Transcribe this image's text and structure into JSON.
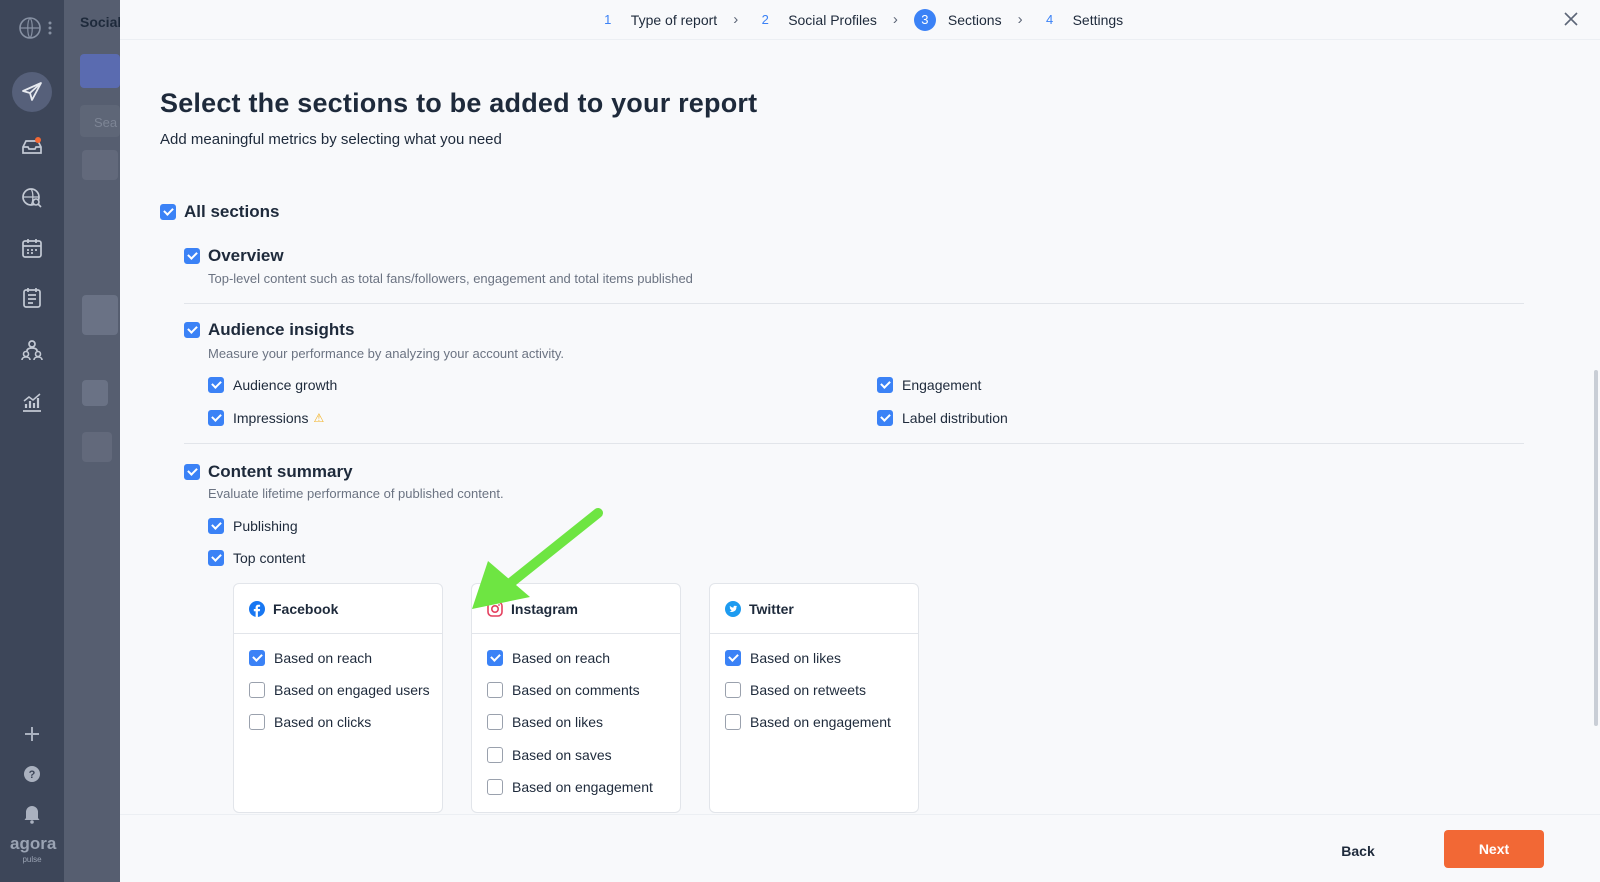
{
  "backdrop": {
    "title": "Social",
    "search_placeholder": "Sea"
  },
  "rail": {
    "logo": "agora",
    "logo_sub": "pulse",
    "icons": [
      "globe-logo-icon",
      "more-icon",
      "send-icon",
      "inbox-icon",
      "listening-icon",
      "calendar-icon",
      "notes-icon",
      "team-icon",
      "reports-icon",
      "add-icon",
      "help-icon",
      "bell-icon"
    ]
  },
  "stepper": {
    "steps": [
      {
        "num": "1",
        "label": "Type of report"
      },
      {
        "num": "2",
        "label": "Social Profiles"
      },
      {
        "num": "3",
        "label": "Sections",
        "active": true
      },
      {
        "num": "4",
        "label": "Settings"
      }
    ]
  },
  "header": {
    "title": "Select the sections to be added to your report",
    "subtitle": "Add meaningful metrics by selecting what you need"
  },
  "sections": {
    "all": {
      "label": "All sections",
      "checked": true
    },
    "overview": {
      "label": "Overview",
      "desc": "Top-level content such as total fans/followers, engagement and total items published",
      "checked": true
    },
    "audience": {
      "label": "Audience insights",
      "desc": "Measure your performance by analyzing your account activity.",
      "checked": true,
      "items": {
        "growth": "Audience growth",
        "impressions": "Impressions",
        "engagement": "Engagement",
        "labels": "Label distribution"
      }
    },
    "content": {
      "label": "Content summary",
      "desc": "Evaluate lifetime performance of published content.",
      "checked": true,
      "publishing": "Publishing",
      "top": "Top content"
    }
  },
  "cards": {
    "facebook": {
      "name": "Facebook",
      "options": [
        {
          "label": "Based on reach",
          "checked": true
        },
        {
          "label": "Based on engaged users",
          "checked": false
        },
        {
          "label": "Based on clicks",
          "checked": false
        }
      ]
    },
    "instagram": {
      "name": "Instagram",
      "options": [
        {
          "label": "Based on reach",
          "checked": true
        },
        {
          "label": "Based on comments",
          "checked": false
        },
        {
          "label": "Based on likes",
          "checked": false
        },
        {
          "label": "Based on saves",
          "checked": false
        },
        {
          "label": "Based on engagement",
          "checked": false
        }
      ]
    },
    "twitter": {
      "name": "Twitter",
      "options": [
        {
          "label": "Based on likes",
          "checked": true
        },
        {
          "label": "Based on retweets",
          "checked": false
        },
        {
          "label": "Based on engagement",
          "checked": false
        }
      ]
    }
  },
  "footer": {
    "back": "Back",
    "next": "Next"
  },
  "colors": {
    "accent": "#3b82f6",
    "next_button": "#f26835",
    "annotation_arrow": "#6ee542"
  }
}
